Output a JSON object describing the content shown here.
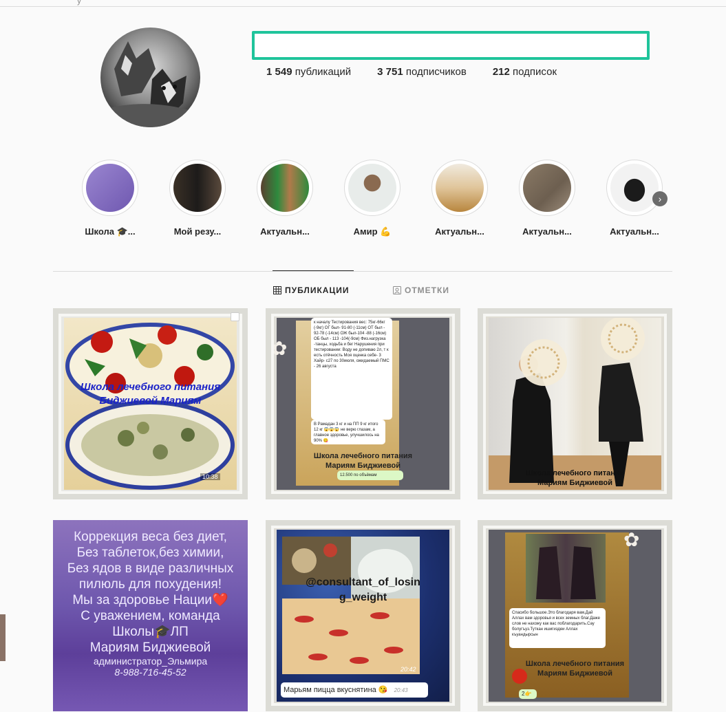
{
  "profile": {
    "stats": [
      {
        "count": "1 549",
        "label": "публикаций"
      },
      {
        "count": "3 751",
        "label": "подписчиков"
      },
      {
        "count": "212",
        "label": "подписок"
      }
    ]
  },
  "highlights": [
    {
      "label": "Школа 🎓..."
    },
    {
      "label": "Мой резу..."
    },
    {
      "label": "Актуальн..."
    },
    {
      "label": "Амир 💪"
    },
    {
      "label": "Актуальн..."
    },
    {
      "label": "Актуальн..."
    },
    {
      "label": "Актуальн..."
    }
  ],
  "tabs": {
    "posts": "ПУБЛИКАЦИИ",
    "tagged": "ОТМЕТКИ"
  },
  "posts": {
    "p1": {
      "line1": "Школа лечебного питания",
      "line2": "Биджиевой Мариям",
      "time": "10:38"
    },
    "p2": {
      "chat1": "к началу Тестирования вес: 75кг-66кг (-9кг) ОГ был- 91-80 (-11см) ОТ был - 92-78 (-14см) ОЖ был-104 -88 (-16см) ОБ был - 113 -104(-9см) Физ.нагрузка -танцы, ходьба и бег Нарушения при тестировании: Воду не допиваю 2л, т к есть отёчность Моя оценка себе- 3 Хайр- с27 по 30июля, ожидаемый ПМС - 26 августа",
      "chat2": "В Рамадан 3 кг и на ПП 9 кг итого 12 кг 😱😱😱 не верю глазам, а главное здоровье, улучшилось на 90% 😋",
      "chat3": "12.500 по объёмам",
      "line1": "Школа лечебного питания",
      "line2": "Мариям Биджиевой"
    },
    "p3": {
      "line1": "Школа лечебного питания",
      "line2": "Мариям Биджиевой"
    },
    "p4": {
      "lines": [
        "Коррекция веса без диет,",
        "Без таблеток,без химии,",
        "Без ядов в виде различных",
        "пилюль для похудения!",
        "Мы за здоровье Нации❤️",
        "С уважением, команда",
        "Школы🎓ЛП",
        "Мариям Биджиевой"
      ],
      "admin": "администратор_Эльмира",
      "phone": "8-988-716-45-52"
    },
    "p5": {
      "line1": "@consultant_of_losin",
      "line2": "g_weight",
      "time": "20:42",
      "caption": "Марьям пицца вкуснятина 😘",
      "time2": "20:43"
    },
    "p6": {
      "chat": "Спасибо большое.Это благодаря вам.Дай Аллах вам здоровья и всех земных благ.Даже слов не нахожу как вас поблагодарить.Сау болугъуз.Туткан ишигиздеи Аллах къуандырсын",
      "line1": "Школа лечебного питания",
      "line2": "Мариям Биджиевой",
      "small": "2👉"
    }
  }
}
